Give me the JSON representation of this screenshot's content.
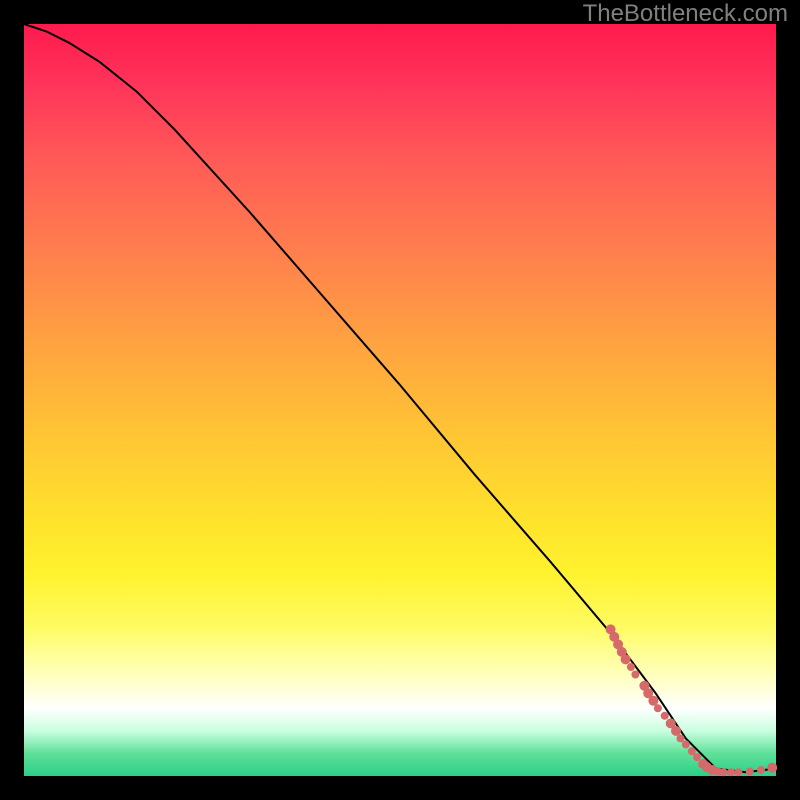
{
  "watermark": "TheBottleneck.com",
  "colors": {
    "background": "#000000",
    "marker": "#d66a6a",
    "curve": "#000000",
    "watermark": "#808080"
  },
  "chart_data": {
    "type": "line",
    "title": "",
    "xlabel": "",
    "ylabel": "",
    "xlim": [
      0,
      100
    ],
    "ylim": [
      0,
      100
    ],
    "curve": {
      "x": [
        0,
        3,
        6,
        10,
        15,
        20,
        30,
        40,
        50,
        60,
        70,
        78,
        84,
        88,
        92,
        96,
        100
      ],
      "y": [
        100,
        99,
        97.5,
        95,
        91,
        86,
        75,
        63.5,
        52,
        40,
        28.5,
        19,
        11,
        5,
        1,
        0.5,
        1
      ]
    },
    "series": [
      {
        "name": "markers",
        "points": [
          {
            "x": 78.0,
            "y": 19.5,
            "r": 5
          },
          {
            "x": 78.5,
            "y": 18.5,
            "r": 5
          },
          {
            "x": 79.0,
            "y": 17.5,
            "r": 5
          },
          {
            "x": 79.5,
            "y": 16.5,
            "r": 5
          },
          {
            "x": 80.0,
            "y": 15.5,
            "r": 5
          },
          {
            "x": 80.7,
            "y": 14.5,
            "r": 4
          },
          {
            "x": 81.3,
            "y": 13.5,
            "r": 4
          },
          {
            "x": 82.5,
            "y": 12.0,
            "r": 5
          },
          {
            "x": 83.0,
            "y": 11.0,
            "r": 5
          },
          {
            "x": 83.7,
            "y": 10.0,
            "r": 5
          },
          {
            "x": 84.3,
            "y": 9.0,
            "r": 4
          },
          {
            "x": 85.2,
            "y": 8.0,
            "r": 4
          },
          {
            "x": 86.0,
            "y": 7.0,
            "r": 5
          },
          {
            "x": 86.7,
            "y": 6.0,
            "r": 5
          },
          {
            "x": 87.3,
            "y": 5.0,
            "r": 4
          },
          {
            "x": 88.0,
            "y": 4.2,
            "r": 4
          },
          {
            "x": 88.8,
            "y": 3.3,
            "r": 4
          },
          {
            "x": 89.5,
            "y": 2.5,
            "r": 4
          },
          {
            "x": 90.3,
            "y": 1.6,
            "r": 5
          },
          {
            "x": 90.8,
            "y": 1.2,
            "r": 5
          },
          {
            "x": 91.5,
            "y": 0.8,
            "r": 5
          },
          {
            "x": 92.3,
            "y": 0.6,
            "r": 4
          },
          {
            "x": 93.0,
            "y": 0.5,
            "r": 4
          },
          {
            "x": 94.0,
            "y": 0.5,
            "r": 4
          },
          {
            "x": 95.0,
            "y": 0.5,
            "r": 4
          },
          {
            "x": 96.5,
            "y": 0.6,
            "r": 4
          },
          {
            "x": 98.0,
            "y": 0.8,
            "r": 4
          },
          {
            "x": 99.5,
            "y": 1.1,
            "r": 5
          }
        ]
      }
    ]
  }
}
